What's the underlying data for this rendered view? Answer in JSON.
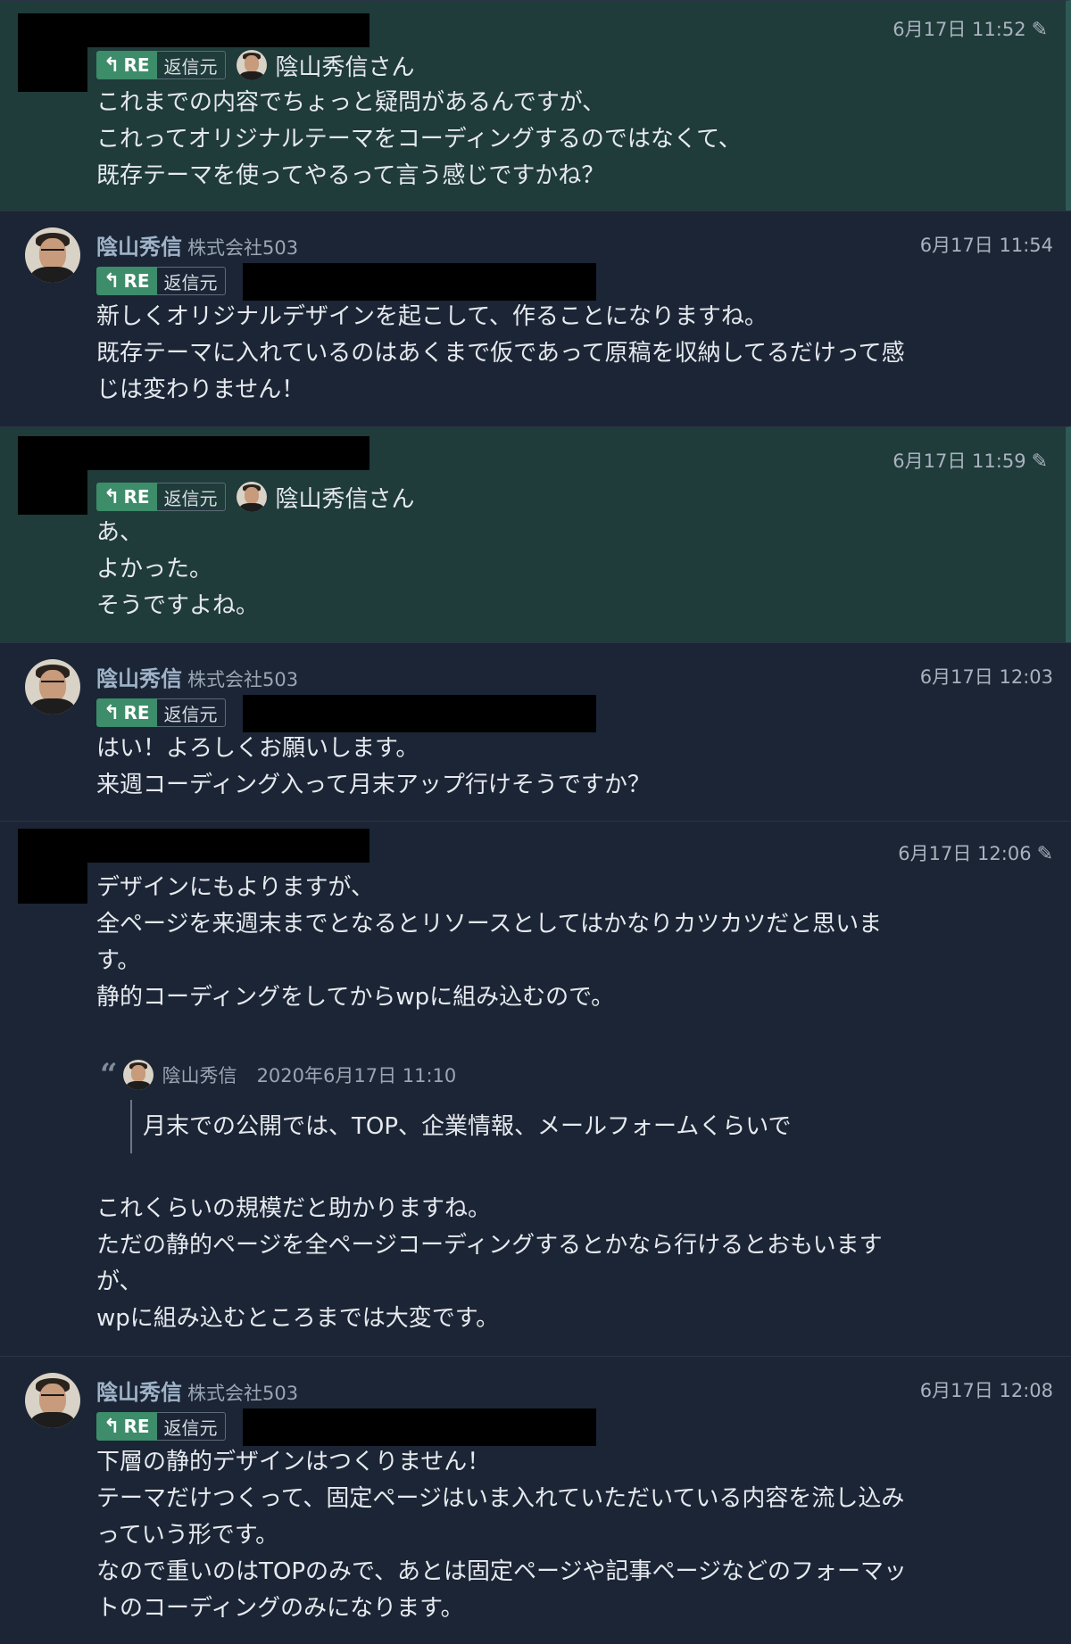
{
  "reply_badge": {
    "re": "RE",
    "src": "返信元"
  },
  "messages": [
    {
      "time": "6月17日 11:52",
      "reply_to": "陰山秀信さん",
      "lines": "これまでの内容でちょっと疑問があるんですが、\nこれってオリジナルテーマをコーディングするのではなくて、\n既存テーマを使ってやるって言う感じですかね？"
    },
    {
      "sender": "陰山秀信",
      "org": "株式会社503",
      "time": "6月17日 11:54",
      "lines": "新しくオリジナルデザインを起こして、作ることになりますね。\n既存テーマに入れているのはあくまで仮であって原稿を収納してるだけって感\nじは変わりません！"
    },
    {
      "time": "6月17日 11:59",
      "reply_to": "陰山秀信さん",
      "lines": "あ、\nよかった。\nそうですよね。"
    },
    {
      "sender": "陰山秀信",
      "org": "株式会社503",
      "time": "6月17日 12:03",
      "lines": "はい！よろしくお願いします。\n来週コーディング入って月末アップ行けそうですか？"
    },
    {
      "time": "6月17日 12:06",
      "lines_before": "デザインにもよりますが、\n全ページを来週末までとなるとリソースとしてはかなりカツカツだと思いま\nす。\n静的コーディングをしてからwpに組み込むので。",
      "quote": {
        "author": "陰山秀信",
        "date": "2020年6月17日 11:10",
        "text": "月末での公開では、TOP、企業情報、メールフォームくらいで"
      },
      "lines_after": "これくらいの規模だと助かりますね。\nただの静的ページを全ページコーディングするとかなら行けるとおもいます\nが、\nwpに組み込むところまでは大変です。"
    },
    {
      "sender": "陰山秀信",
      "org": "株式会社503",
      "time": "6月17日 12:08",
      "lines": "下層の静的デザインはつくりません！\nテーマだけつくって、固定ページはいま入れていただいている内容を流し込み\nっていう形です。\nなので重いのはTOPのみで、あとは固定ページや記事ページなどのフォーマッ\nトのコーディングのみになります。"
    }
  ]
}
